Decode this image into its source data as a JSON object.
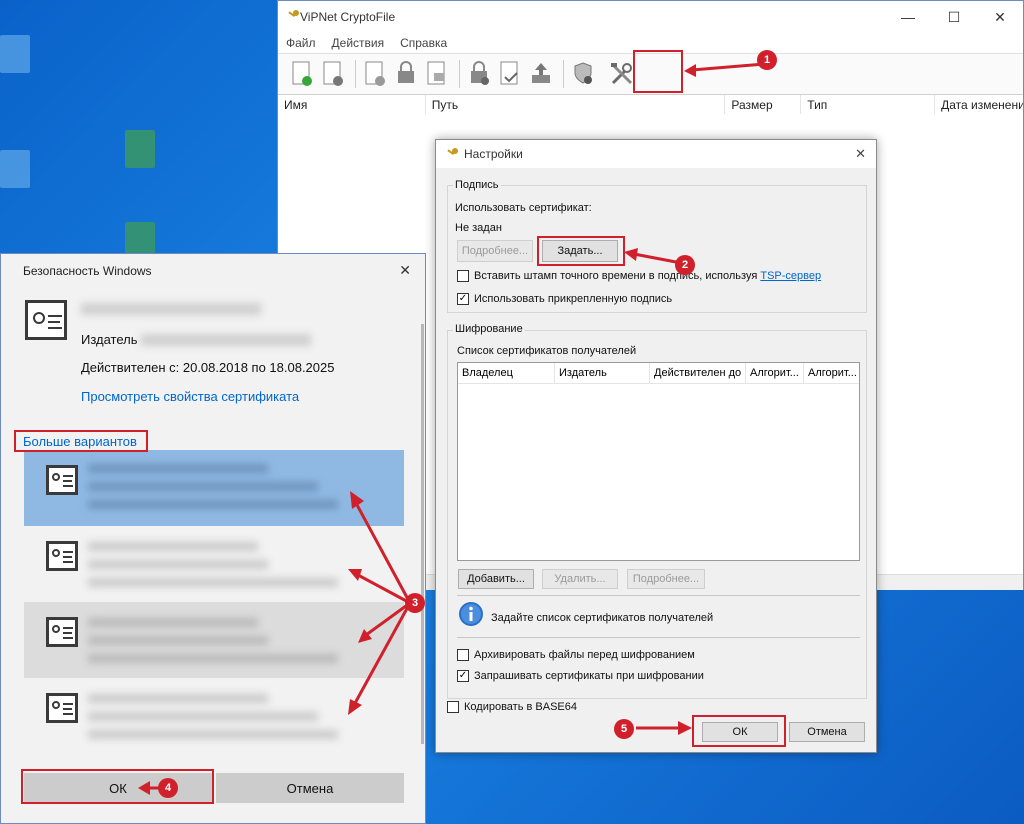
{
  "main_window": {
    "title": "ViPNet CryptoFile",
    "menu": [
      "Файл",
      "Действия",
      "Справка"
    ],
    "columns": [
      "Имя",
      "Путь",
      "Размер",
      "Тип",
      "Дата изменени"
    ]
  },
  "settings_dialog": {
    "title": "Настройки",
    "signature": {
      "group_label": "Подпись",
      "use_cert_label": "Использовать сертификат:",
      "cert_value": "Не задан",
      "details_button": "Подробнее...",
      "set_button": "Задать...",
      "timestamp_label": "Вставить штамп точного времени в подпись, используя",
      "tsp_link": "TSP-сервер",
      "timestamp_checked": false,
      "attached_label": "Использовать прикрепленную подпись",
      "attached_checked": true
    },
    "encryption": {
      "group_label": "Шифрование",
      "list_label": "Список сертификатов получателей",
      "columns": [
        "Владелец",
        "Издатель",
        "Действителен до",
        "Алгорит...",
        "Алгорит..."
      ],
      "add_button": "Добавить...",
      "delete_button": "Удалить...",
      "details_button": "Подробнее...",
      "info_text": "Задайте список сертификатов получателей",
      "archive_label": "Архивировать файлы перед шифрованием",
      "archive_checked": false,
      "request_label": "Запрашивать сертификаты при шифровании",
      "request_checked": true
    },
    "base64_label": "Кодировать в BASE64",
    "base64_checked": false,
    "ok_button": "ОК",
    "cancel_button": "Отмена"
  },
  "security_dialog": {
    "title": "Безопасность Windows",
    "issuer_label": "Издатель",
    "valid_text": "Действителен с: 20.08.2018 по 18.08.2025",
    "view_props_link": "Просмотреть свойства сертификата",
    "more_options": "Больше вариантов",
    "ok_button": "ОК",
    "cancel_button": "Отмена"
  },
  "annotations": [
    "1",
    "2",
    "3",
    "4",
    "5"
  ],
  "colors": {
    "annotation_red": "#d0202c",
    "selected_row": "#8fb9e3",
    "link_blue": "#0066cc"
  }
}
